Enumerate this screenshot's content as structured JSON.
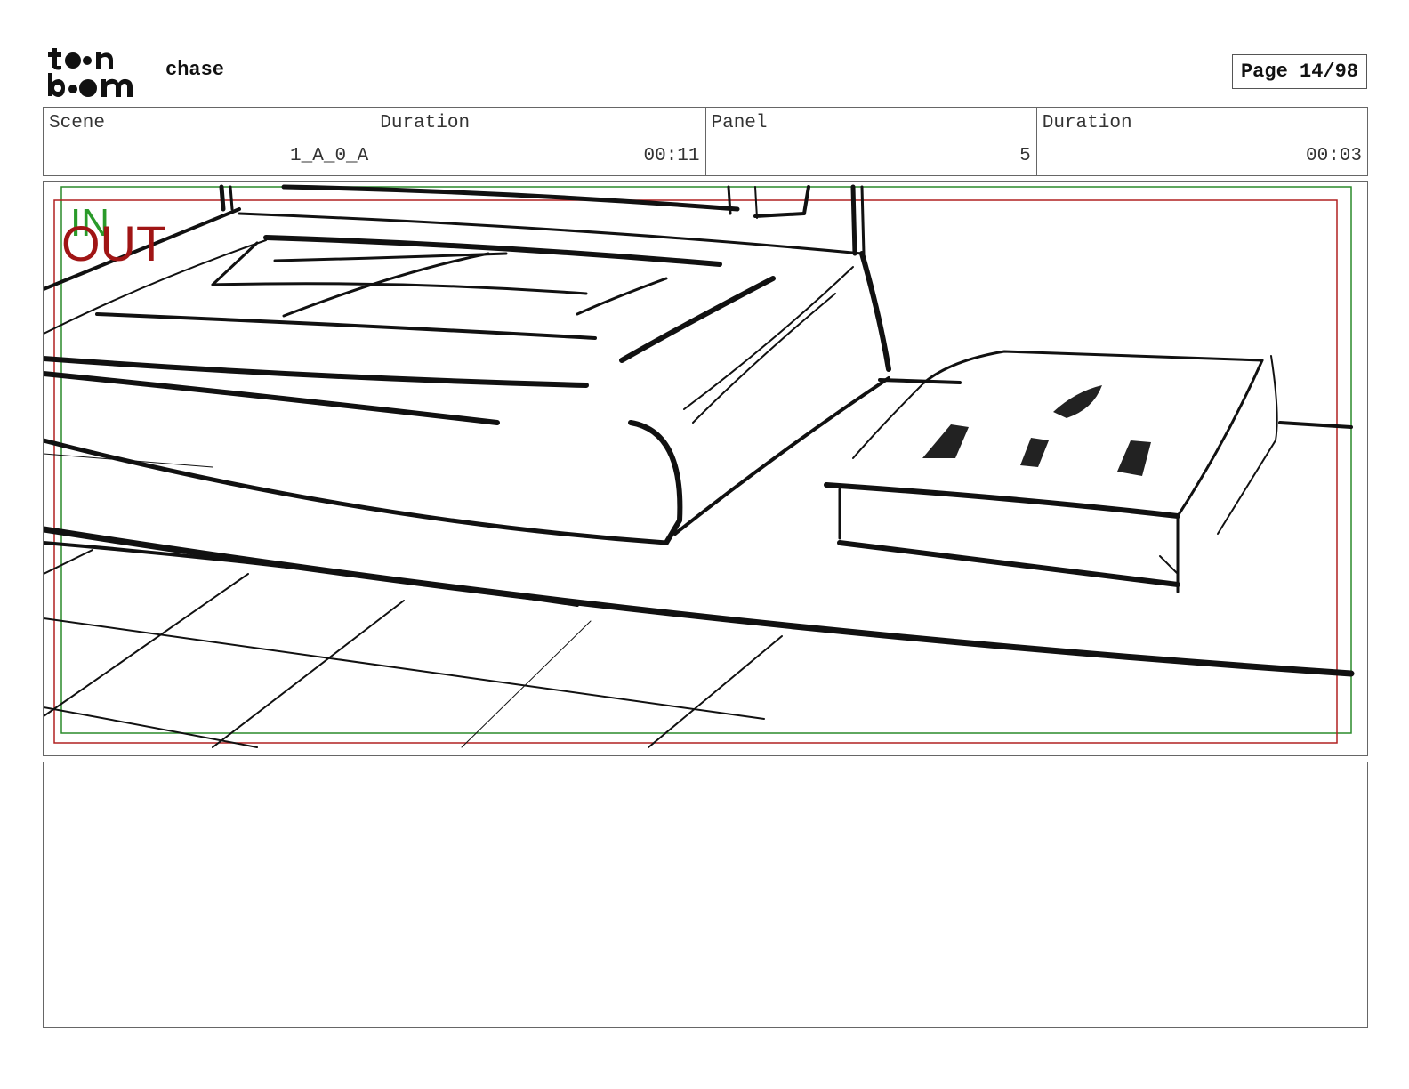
{
  "header": {
    "project_title": "chase",
    "page_label": "Page 14/98"
  },
  "logo": {
    "text": "toon boom"
  },
  "info": [
    {
      "label": "Scene",
      "value": "1_A_0_A"
    },
    {
      "label": "Duration",
      "value": "00:11"
    },
    {
      "label": "Panel",
      "value": "5"
    },
    {
      "label": "Duration",
      "value": "00:03"
    }
  ],
  "panel": {
    "in_label": "IN",
    "out_label": "OUT",
    "in_color": "#2a9a2a",
    "out_color": "#a01515"
  },
  "notes": {
    "text": ""
  }
}
